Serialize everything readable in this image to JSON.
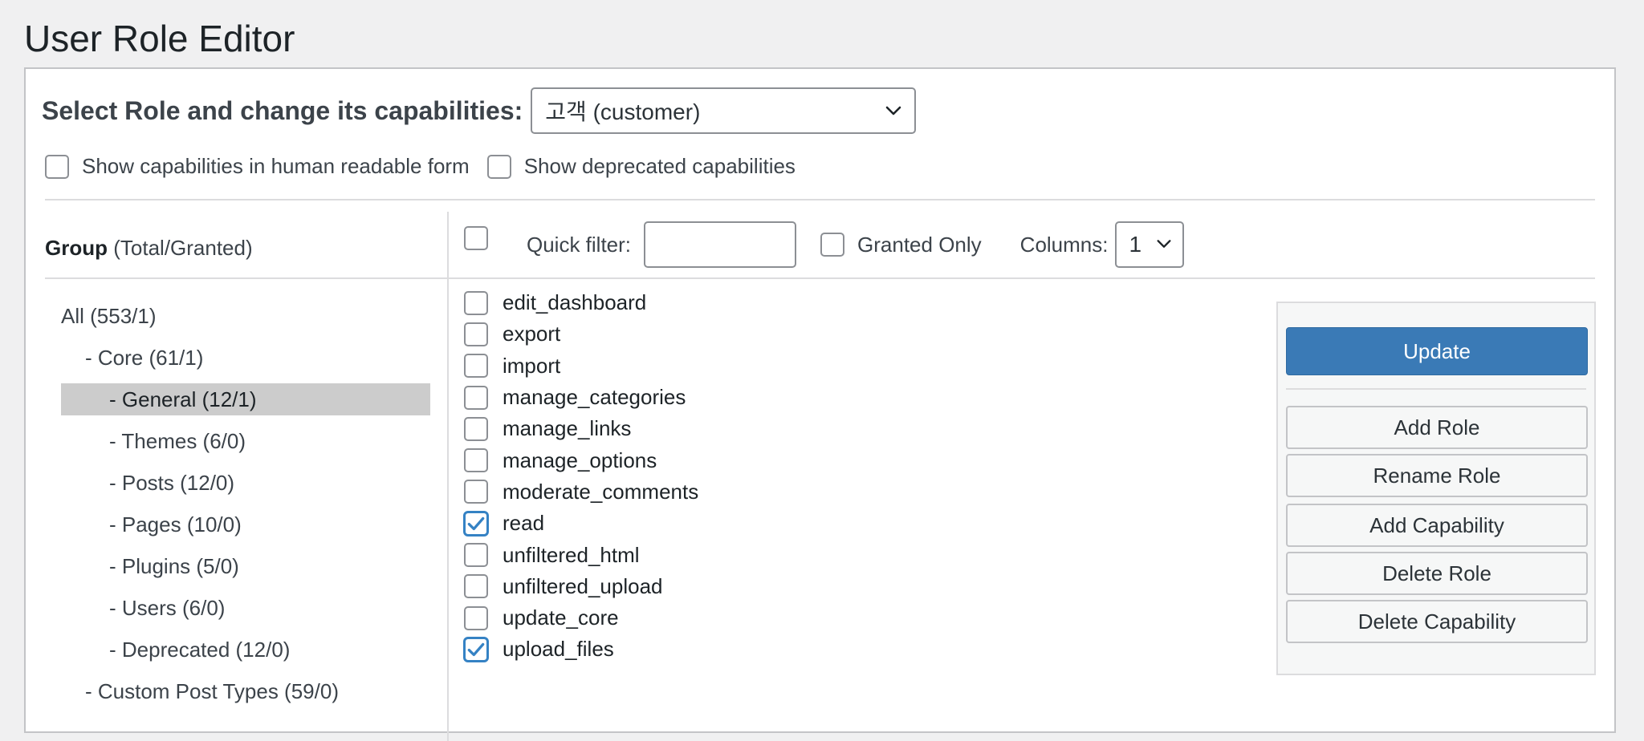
{
  "page": {
    "title": "User Role Editor"
  },
  "role_selector": {
    "label": "Select Role and change its capabilities:",
    "selected": "고객 (customer)"
  },
  "options": {
    "human_readable": {
      "label": "Show capabilities in human readable form",
      "checked": false
    },
    "deprecated": {
      "label": "Show deprecated capabilities",
      "checked": false
    }
  },
  "groups_header": {
    "title": "Group",
    "subtitle": "(Total/Granted)"
  },
  "filter_bar": {
    "quick_filter_label": "Quick filter:",
    "quick_filter_value": "",
    "granted_only_label": "Granted Only",
    "columns_label": "Columns:",
    "columns_value": "1"
  },
  "groups": [
    {
      "label": "All (553/1)",
      "level": 0,
      "selected": false
    },
    {
      "label": "- Core (61/1)",
      "level": 1,
      "selected": false
    },
    {
      "label": "- General (12/1)",
      "level": 2,
      "selected": true
    },
    {
      "label": "- Themes (6/0)",
      "level": 2,
      "selected": false
    },
    {
      "label": "- Posts (12/0)",
      "level": 2,
      "selected": false
    },
    {
      "label": "- Pages (10/0)",
      "level": 2,
      "selected": false
    },
    {
      "label": "- Plugins (5/0)",
      "level": 2,
      "selected": false
    },
    {
      "label": "- Users (6/0)",
      "level": 2,
      "selected": false
    },
    {
      "label": "- Deprecated (12/0)",
      "level": 2,
      "selected": false
    },
    {
      "label": "- Custom Post Types (59/0)",
      "level": 1,
      "selected": false
    }
  ],
  "capabilities": [
    {
      "name": "edit_dashboard",
      "checked": false
    },
    {
      "name": "export",
      "checked": false
    },
    {
      "name": "import",
      "checked": false
    },
    {
      "name": "manage_categories",
      "checked": false
    },
    {
      "name": "manage_links",
      "checked": false
    },
    {
      "name": "manage_options",
      "checked": false
    },
    {
      "name": "moderate_comments",
      "checked": false
    },
    {
      "name": "read",
      "checked": true
    },
    {
      "name": "unfiltered_html",
      "checked": false
    },
    {
      "name": "unfiltered_upload",
      "checked": false
    },
    {
      "name": "update_core",
      "checked": false
    },
    {
      "name": "upload_files",
      "checked": true
    }
  ],
  "actions": {
    "update": "Update",
    "add_role": "Add Role",
    "rename_role": "Rename Role",
    "add_capability": "Add Capability",
    "delete_role": "Delete Role",
    "delete_capability": "Delete Capability"
  },
  "colors": {
    "accent": "#3a7ab6",
    "check": "#3582c4",
    "selected_group_bg": "#cccccc"
  }
}
